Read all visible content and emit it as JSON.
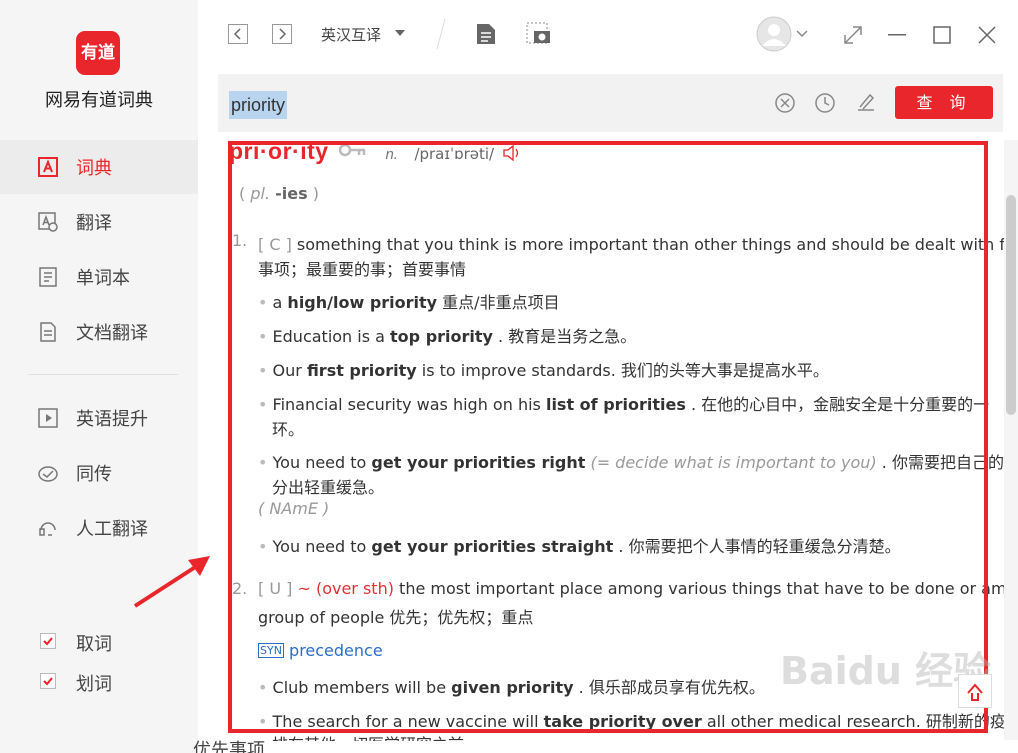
{
  "app": {
    "logo_text": "有道",
    "name": "网易有道词典",
    "brand_color": "#e8262b"
  },
  "sidebar": {
    "items": [
      {
        "label": "词典",
        "icon": "dictionary-icon"
      },
      {
        "label": "翻译",
        "icon": "translate-icon"
      },
      {
        "label": "单词本",
        "icon": "wordbook-icon"
      },
      {
        "label": "文档翻译",
        "icon": "document-translate-icon"
      },
      {
        "label": "英语提升",
        "icon": "play-icon"
      },
      {
        "label": "同传",
        "icon": "simultaneous-icon"
      },
      {
        "label": "人工翻译",
        "icon": "headset-icon"
      }
    ],
    "checks": [
      {
        "label": "取词",
        "checked": true
      },
      {
        "label": "划词",
        "checked": true
      }
    ]
  },
  "toolbar": {
    "mode": "英汉互译"
  },
  "search": {
    "value": "priority",
    "button": "查 询"
  },
  "entry": {
    "headword": "pri·or·ity",
    "pos": "n.",
    "ipa": "/praɪˈɒrəti/",
    "plural_label": "pl.",
    "plural": "-ies",
    "senses": [
      {
        "num": "1.",
        "grammar": "[ C ]",
        "def_line1": "something that you think is more important than other things and should be dealt with first 优先",
        "def_line2": "事项；最重要的事；首要事情",
        "ex1": {
          "a": "a ",
          "b": "high/low priority",
          "c": " 重点/非重点项目"
        },
        "ex2": {
          "a": "Education is a ",
          "b": "top priority",
          "c": " . 教育是当务之急。"
        },
        "ex3": {
          "a": "Our ",
          "b": "first priority",
          "c": " is to improve standards. 我们的头等大事是提高水平。"
        },
        "ex4": {
          "a": "Financial security was high on his ",
          "b": "list of priorities",
          "c": " . 在他的心目中，金融安全是十分重要的一",
          "d": "环。"
        },
        "ex5": {
          "a": "You need to ",
          "b": "get your priorities right",
          "i": " (= decide what is important to you)",
          "c": " . 你需要把自己的事情",
          "d": "分出轻重缓急。"
        },
        "region": "( NAmE )",
        "ex6": {
          "a": "You need to ",
          "b": "get your priorities straight",
          "c": " . 你需要把个人事情的轻重缓急分清楚。"
        }
      },
      {
        "num": "2.",
        "grammar": "[ U ]",
        "pattern": "~ (over sth)",
        "def_line1": " the most important place among various things that have to be done or among a",
        "def_line2": "group of people 优先；优先权；重点",
        "syn_tag": "SYN",
        "syn_word": "precedence",
        "ex1": {
          "a": "Club members will be ",
          "b": "given priority",
          "c": " . 俱乐部成员享有优先权。"
        },
        "ex2": {
          "a": "The search for a new vaccine will ",
          "b": "take priority over",
          "c": " all other medical research. 研制新的疫苗将",
          "d": "排在其他一切医学研究之前"
        }
      }
    ]
  },
  "watermark": "Baidu 经验",
  "bottom_text": "优先事项"
}
